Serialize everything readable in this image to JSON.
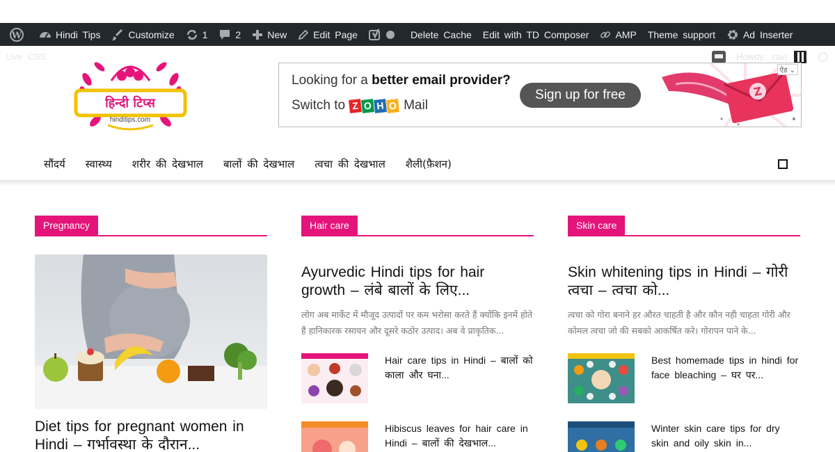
{
  "adminbar": {
    "site_name": "Hindi Tips",
    "customize": "Customize",
    "updates_count": "1",
    "comments_count": "2",
    "new": "New",
    "edit_page": "Edit Page",
    "delete_cache": "Delete Cache",
    "edit_with": "Edit with TD Composer",
    "amp": "AMP",
    "theme_support": "Theme support",
    "ad_inserter": "Ad Inserter",
    "howdy": "Howdy, ravi"
  },
  "subbar": {
    "live_css": "Live CSS"
  },
  "logo": {
    "hindi": "हिन्दी टिप्स",
    "domain": "hinditips.com"
  },
  "ad": {
    "line1_plain": "Looking for a ",
    "line1_bold": "better email provider?",
    "line2_prefix": "Switch to",
    "brand_letters": [
      "Z",
      "O",
      "H",
      "O"
    ],
    "line2_suffix": "Mail",
    "cta": "Sign up for free",
    "badge": "ऐड ⌄"
  },
  "nav": {
    "items": [
      "सौंदर्य",
      "स्वास्थ्य",
      "शरीर की देखभाल",
      "बालों की देखभाल",
      "त्वचा की देखभाल",
      "शैली(फ़ैशन)"
    ]
  },
  "colors": {
    "accent": "#e5147a",
    "adminbar": "#23282d"
  },
  "columns": [
    {
      "category": "Pregnancy",
      "title": "Diet tips for pregnant women in Hindi – गर्भावस्था के दौरान...",
      "image": "pregnant-woman-food-image"
    },
    {
      "category": "Hair care",
      "title": "Ayurvedic Hindi tips for hair growth – लंबे बालों के लिए...",
      "excerpt": "लोग अब मार्केट में मौजूद उत्पादों पर कम भरोसा करते हैं क्योंकि इनमें होते हैं हानिकारक रसायन और दूसरे कठोर उत्पाद। अब वे प्राकृतिक...",
      "items": [
        {
          "title": "Hair care tips in Hindi – बालों को काला और घना..."
        },
        {
          "title": "Hibiscus leaves for hair care in Hindi – बालों की देखभाल..."
        }
      ]
    },
    {
      "category": "Skin care",
      "title": "Skin whitening tips in Hindi – गोरी त्वचा – त्वचा को...",
      "excerpt": "त्वचा को गोरा बनाने हर औरत चाहती है और कौन नही चाहता गोरी और कोमल त्वचा जो की सबको आकर्षित करे। गोरापन पाने के...",
      "items": [
        {
          "title": "Best homemade tips in hindi for face bleaching – घर पर..."
        },
        {
          "title": "Winter skin care tips for dry skin and oily skin in..."
        }
      ]
    }
  ]
}
